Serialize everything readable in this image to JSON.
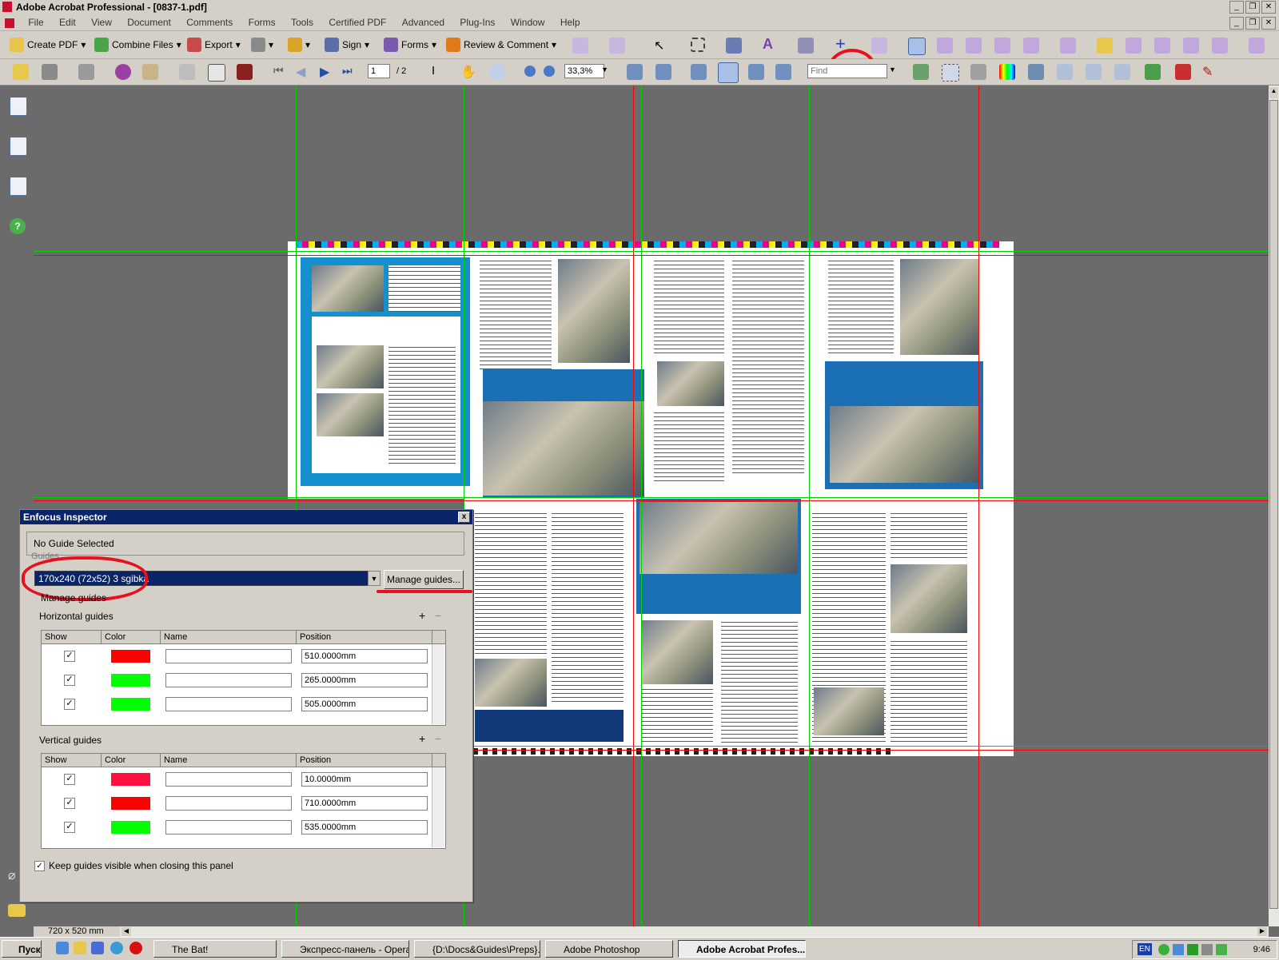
{
  "window": {
    "title": "Adobe Acrobat Professional - [0837-1.pdf]"
  },
  "menu": [
    "File",
    "Edit",
    "View",
    "Document",
    "Comments",
    "Forms",
    "Tools",
    "Certified PDF",
    "Advanced",
    "Plug-Ins",
    "Window",
    "Help"
  ],
  "toolbar": {
    "create_pdf": "Create PDF",
    "combine_files": "Combine Files",
    "export": "Export",
    "sign": "Sign",
    "forms": "Forms",
    "review_comment": "Review & Comment"
  },
  "navbar": {
    "page_current": "1",
    "page_total": "/ 2",
    "zoom": "33,3%",
    "find_placeholder": "Find"
  },
  "status": {
    "page_size": "720 x 520 mm"
  },
  "inspector": {
    "title": "Enfocus Inspector",
    "close": "x",
    "status": "No Guide Selected",
    "tab": "Guides",
    "preset": "170x240 (72x52) 3 sgibka",
    "manage_button": "Manage guides...",
    "manage_group": "Manage guides",
    "horizontal_label": "Horizontal guides",
    "vertical_label": "Vertical guides",
    "columns": {
      "show": "Show",
      "color": "Color",
      "name": "Name",
      "position": "Position"
    },
    "horizontal_guides": [
      {
        "show": true,
        "color": "#ff0000",
        "name": "",
        "position": "510.0000mm"
      },
      {
        "show": true,
        "color": "#00ff00",
        "name": "",
        "position": "265.0000mm"
      },
      {
        "show": true,
        "color": "#00ff00",
        "name": "",
        "position": "505.0000mm"
      }
    ],
    "vertical_guides": [
      {
        "show": true,
        "color": "#ff1040",
        "name": "",
        "position": "10.0000mm"
      },
      {
        "show": true,
        "color": "#ff0000",
        "name": "",
        "position": "710.0000mm"
      },
      {
        "show": true,
        "color": "#00ff00",
        "name": "",
        "position": "535.0000mm"
      }
    ],
    "keep_visible": "Keep guides visible when closing this panel",
    "add": "+",
    "remove": "−"
  },
  "taskbar": {
    "start": "Пуск",
    "tasks": [
      {
        "label": "The Bat!",
        "active": false
      },
      {
        "label": "Экспресс-панель - Opera",
        "active": false
      },
      {
        "label": "{D:\\Docs&Guides\\Preps}...",
        "active": false
      },
      {
        "label": "Adobe Photoshop",
        "active": false
      },
      {
        "label": "Adobe Acrobat Profes...",
        "active": true
      }
    ],
    "lang": "EN",
    "clock": "9:46"
  },
  "colors": {
    "accent": "#0a246a",
    "annotation": "#e8101e",
    "guide_green": "#00ff00",
    "guide_red": "#ff0000"
  },
  "icons": [
    "create-pdf-icon",
    "combine-files-icon",
    "export-icon",
    "lock-icon",
    "sign-icon",
    "forms-icon",
    "review-icon",
    "select-arrow-icon",
    "marquee-icon",
    "text-touchup-icon",
    "guide-tool-icon",
    "open-icon",
    "print-icon",
    "email-icon",
    "first-page-icon",
    "prev-page-icon",
    "next-page-icon",
    "last-page-icon",
    "hand-icon",
    "zoom-icon",
    "pages-icon",
    "bookmarks-icon",
    "signatures-icon",
    "help-icon",
    "paperclip-icon",
    "comment-icon"
  ]
}
